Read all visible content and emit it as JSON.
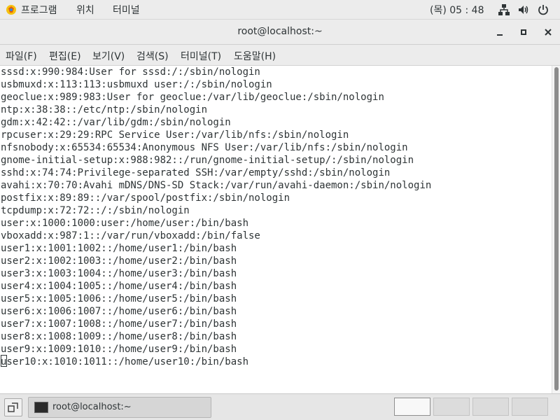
{
  "topbar": {
    "apps_label": "프로그램",
    "places_label": "위치",
    "terminal_label": "터미널",
    "clock": "(목) 05 : 48"
  },
  "window": {
    "title": "root@localhost:~"
  },
  "menubar": {
    "items": [
      "파일(F)",
      "편집(E)",
      "보기(V)",
      "검색(S)",
      "터미널(T)",
      "도움말(H)"
    ]
  },
  "terminal": {
    "lines": [
      "sssd:x:990:984:User for sssd:/:/sbin/nologin",
      "usbmuxd:x:113:113:usbmuxd user:/:/sbin/nologin",
      "geoclue:x:989:983:User for geoclue:/var/lib/geoclue:/sbin/nologin",
      "ntp:x:38:38::/etc/ntp:/sbin/nologin",
      "gdm:x:42:42::/var/lib/gdm:/sbin/nologin",
      "rpcuser:x:29:29:RPC Service User:/var/lib/nfs:/sbin/nologin",
      "nfsnobody:x:65534:65534:Anonymous NFS User:/var/lib/nfs:/sbin/nologin",
      "gnome-initial-setup:x:988:982::/run/gnome-initial-setup/:/sbin/nologin",
      "sshd:x:74:74:Privilege-separated SSH:/var/empty/sshd:/sbin/nologin",
      "avahi:x:70:70:Avahi mDNS/DNS-SD Stack:/var/run/avahi-daemon:/sbin/nologin",
      "postfix:x:89:89::/var/spool/postfix:/sbin/nologin",
      "tcpdump:x:72:72::/:/sbin/nologin",
      "user:x:1000:1000:user:/home/user:/bin/bash",
      "vboxadd:x:987:1::/var/run/vboxadd:/bin/false",
      "user1:x:1001:1002::/home/user1:/bin/bash",
      "user2:x:1002:1003::/home/user2:/bin/bash",
      "user3:x:1003:1004::/home/user3:/bin/bash",
      "user4:x:1004:1005::/home/user4:/bin/bash",
      "user5:x:1005:1006::/home/user5:/bin/bash",
      "user6:x:1006:1007::/home/user6:/bin/bash",
      "user7:x:1007:1008::/home/user7:/bin/bash",
      "user8:x:1008:1009::/home/user8:/bin/bash",
      "user9:x:1009:1010::/home/user9:/bin/bash",
      "user10:x:1010:1011::/home/user10:/bin/bash"
    ]
  },
  "taskbar": {
    "task_label": "root@localhost:~",
    "workspaces": 4,
    "active_workspace": 1
  }
}
